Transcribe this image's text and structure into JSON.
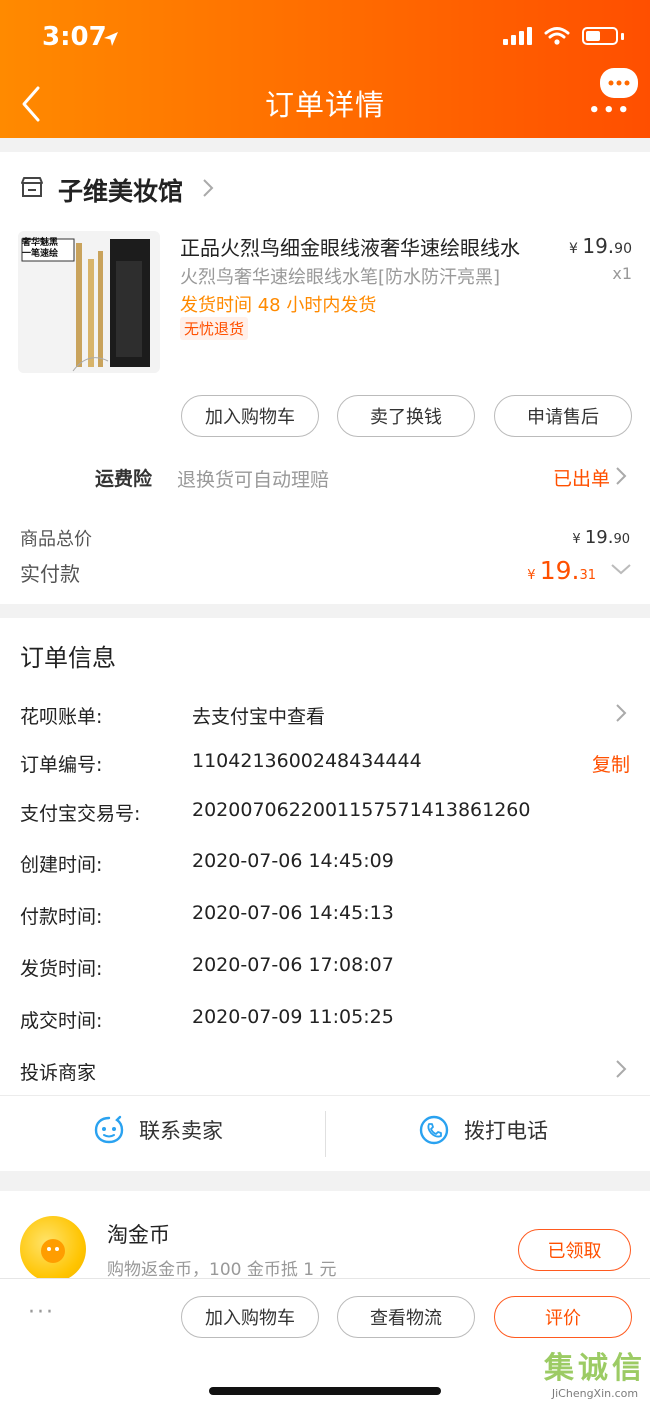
{
  "status": {
    "time": "3:07"
  },
  "header": {
    "title": "订单详情"
  },
  "store": {
    "name": "子维美妆馆"
  },
  "product": {
    "title": "正品火烈鸟细金眼线液奢华速绘眼线水",
    "spec": "火烈鸟奢华速绘眼线水笔[防水防汗亮黑]",
    "shipping": "发货时间 48 小时内发货",
    "tag": "无忧退货",
    "price_symbol": "¥ ",
    "price_int": "19.",
    "price_dec": "90",
    "qty": "x1",
    "box_text": "奢华魅黑\n一笔速绘"
  },
  "actions1": {
    "cart": "加入购物车",
    "resell": "卖了换钱",
    "aftersale": "申请售后"
  },
  "insurance": {
    "label": "运费险",
    "desc": "退换货可自动理赔",
    "status": "已出单"
  },
  "summary": {
    "total_label": "商品总价",
    "total_symbol": "¥ ",
    "total_int": "19.",
    "total_dec": "90",
    "paid_label": "实付款",
    "paid_symbol": "¥ ",
    "paid_int": "19.",
    "paid_dec": "31"
  },
  "order_info": {
    "title": "订单信息",
    "huabei_label": "花呗账单:",
    "huabei_value": "去支付宝中查看",
    "order_no_label": "订单编号:",
    "order_no": "1104213600248434444",
    "copy": "复制",
    "alipay_label": "支付宝交易号:",
    "alipay_no": "2020070622001157571413861260",
    "created_label": "创建时间:",
    "created": "2020-07-06 14:45:09",
    "paid_label": "付款时间:",
    "paid": "2020-07-06 14:45:13",
    "shipped_label": "发货时间:",
    "shipped": "2020-07-06 17:08:07",
    "closed_label": "成交时间:",
    "closed": "2020-07-09 11:05:25",
    "complain": "投诉商家"
  },
  "contact": {
    "seller": "联系卖家",
    "call": "拨打电话"
  },
  "coins": {
    "name": "淘金币",
    "desc": "购物返金币，100 金币抵 1 元",
    "status": "已领取"
  },
  "bottom": {
    "more": "···",
    "cart": "加入购物车",
    "logistics": "查看物流",
    "review": "评价"
  },
  "watermark": {
    "main": "集诚信",
    "sub": "JiChengXin.com"
  },
  "colors": {
    "accent": "#ff5000",
    "header_start": "#ff8a00",
    "header_end": "#ff4f00"
  }
}
